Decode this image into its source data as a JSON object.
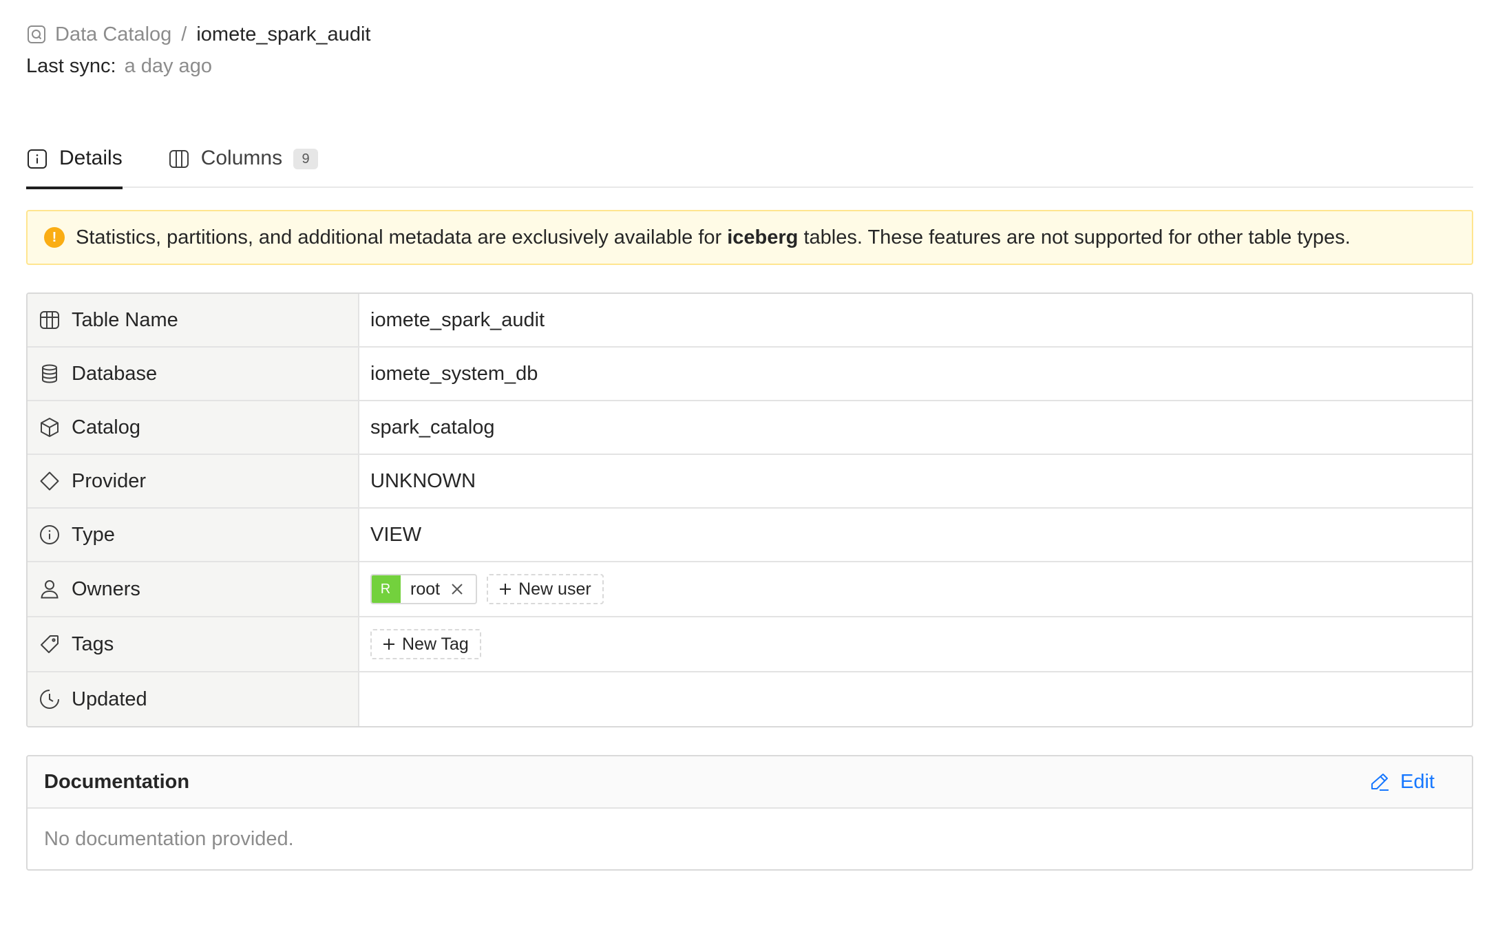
{
  "breadcrumb": {
    "root_label": "Data Catalog",
    "separator": "/",
    "current": "iomete_spark_audit"
  },
  "sync": {
    "label": "Last sync:",
    "value": "a day ago"
  },
  "tabs": [
    {
      "label": "Details",
      "icon": "info-icon",
      "active": true
    },
    {
      "label": "Columns",
      "icon": "columns-icon",
      "badge": "9",
      "active": false
    }
  ],
  "alert": {
    "icon": "warning-icon",
    "text_before": "Statistics, partitions, and additional metadata are exclusively available for ",
    "text_bold": "iceberg",
    "text_after": " tables. These features are not supported for other table types."
  },
  "details": {
    "rows": [
      {
        "label": "Table Name",
        "icon": "table-icon",
        "value": "iomete_spark_audit"
      },
      {
        "label": "Database",
        "icon": "database-icon",
        "value": "iomete_system_db"
      },
      {
        "label": "Catalog",
        "icon": "cube-icon",
        "value": "spark_catalog"
      },
      {
        "label": "Provider",
        "icon": "diamond-icon",
        "value": "UNKNOWN"
      },
      {
        "label": "Type",
        "icon": "info-icon",
        "value": "VIEW"
      },
      {
        "label": "Owners",
        "icon": "user-icon"
      },
      {
        "label": "Tags",
        "icon": "tag-icon"
      },
      {
        "label": "Updated",
        "icon": "clock-icon",
        "value": ""
      }
    ],
    "owners": [
      {
        "avatar_letter": "R",
        "name": "root"
      }
    ],
    "new_user_label": "New user",
    "new_tag_label": "New Tag"
  },
  "documentation": {
    "title": "Documentation",
    "edit_label": "Edit",
    "empty_text": "No documentation provided."
  },
  "colors": {
    "accent": "#1677ff",
    "alert_bg": "#fffbe6",
    "alert_border": "#ffe58f",
    "warning": "#faad14",
    "avatar": "#73d13d"
  }
}
